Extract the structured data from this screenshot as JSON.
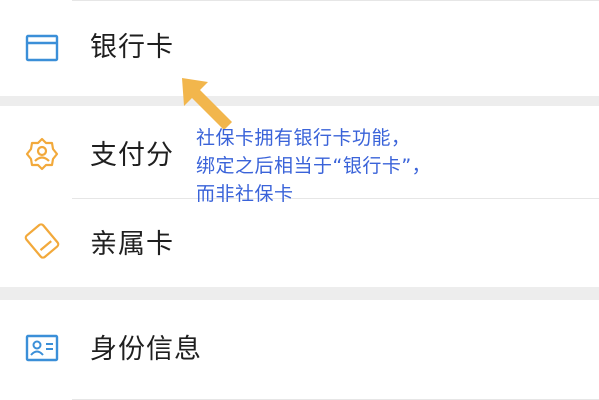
{
  "menu": {
    "items": [
      {
        "label": "银行卡",
        "icon": "card-icon"
      },
      {
        "label": "支付分",
        "icon": "payscore-icon"
      },
      {
        "label": "亲属卡",
        "icon": "family-card-icon"
      },
      {
        "label": "身份信息",
        "icon": "id-card-icon"
      }
    ]
  },
  "annotation": {
    "lines": [
      "社保卡拥有银行卡功能，",
      "绑定之后相当于“银行卡”，",
      "而非社保卡"
    ],
    "color": "#3a63d9",
    "arrow_color": "#f2b64c"
  },
  "colors": {
    "icon_blue": "#3b8fd8",
    "icon_orange": "#f2a93b",
    "text": "#1f1f1f",
    "background": "#ededed"
  }
}
